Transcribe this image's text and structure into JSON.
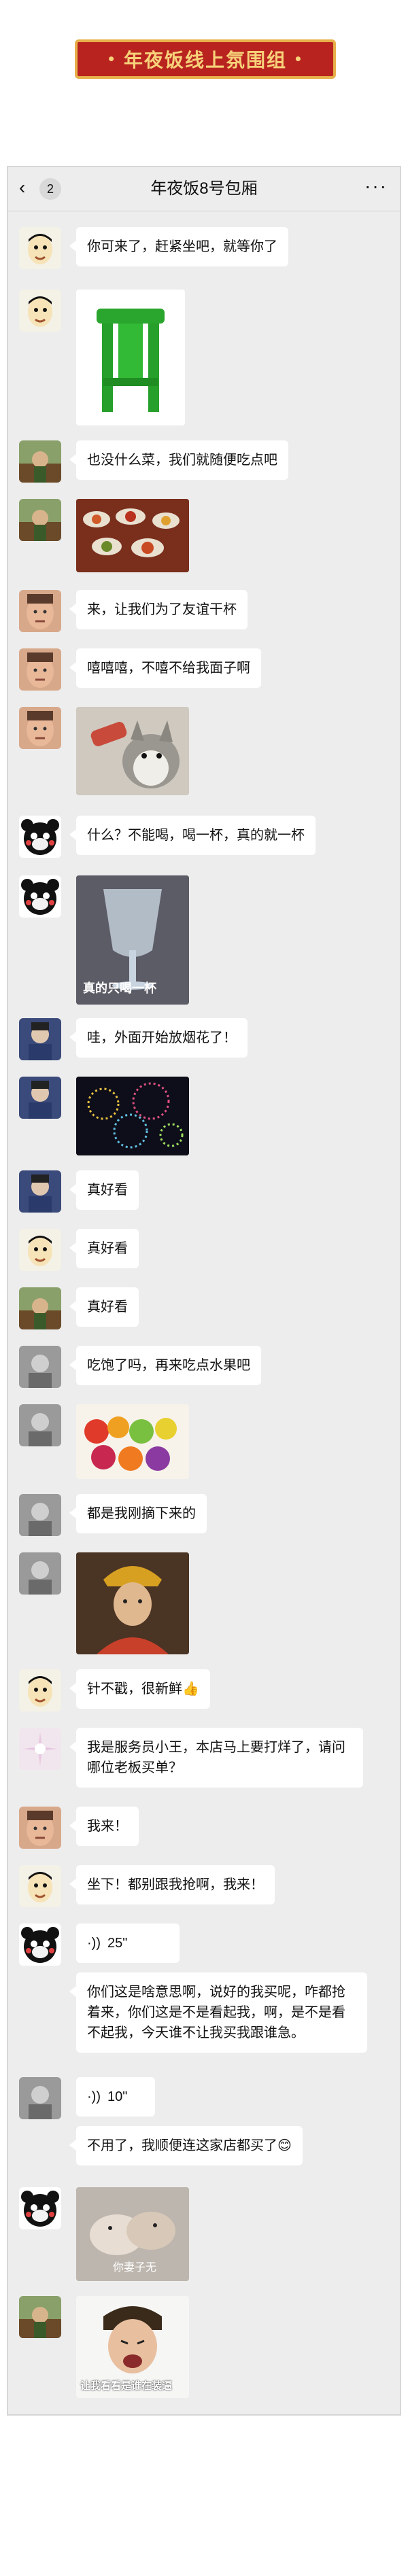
{
  "banner": {
    "title": "年夜饭线上氛围组"
  },
  "chat": {
    "title": "年夜饭8号包厢",
    "back_count": "2",
    "more": "···"
  },
  "messages": [
    {
      "text": "你可来了，赶紧坐吧，就等你了"
    },
    {
      "image": "green-stool"
    },
    {
      "text": "也没什么菜，我们就随便吃点吧"
    },
    {
      "image": "feast-table"
    },
    {
      "text": "来，让我们为了友谊干杯"
    },
    {
      "text": "嘻嘻嘻，不嘻不给我面子啊"
    },
    {
      "image": "dog-drinking"
    },
    {
      "text": "什么？不能喝，喝一杯，真的就一杯"
    },
    {
      "image": "big-glass",
      "caption": "真的只喝一杯"
    },
    {
      "text": "哇，外面开始放烟花了！"
    },
    {
      "image": "fireworks"
    },
    {
      "text": "真好看"
    },
    {
      "text": "真好看"
    },
    {
      "text": "真好看"
    },
    {
      "text": "吃饱了吗，再来吃点水果吧"
    },
    {
      "image": "fruit"
    },
    {
      "text": "都是我刚摘下来的"
    },
    {
      "image": "monk"
    },
    {
      "text": "针不戳，很新鲜👍"
    },
    {
      "text": "我是服务员小王，本店马上要打烊了，请问哪位老板买单？"
    },
    {
      "text": "我来！"
    },
    {
      "text": "坐下！都别跟我抢啊，我来！"
    },
    {
      "voice": "25\""
    },
    {
      "text": "你们这是啥意思啊，说好的我买呢，咋都抢着来，你们这是不是看起我，啊，是不是看不起我，今天谁不让我买我跟谁急。"
    },
    {
      "voice": "10\""
    },
    {
      "text": "不用了，我顺便连这家店都买了😊"
    },
    {
      "image": "dogs-fight",
      "caption": "你妻子无"
    },
    {
      "image": "crying-man",
      "caption": "让我看看是谁在装逼"
    }
  ]
}
